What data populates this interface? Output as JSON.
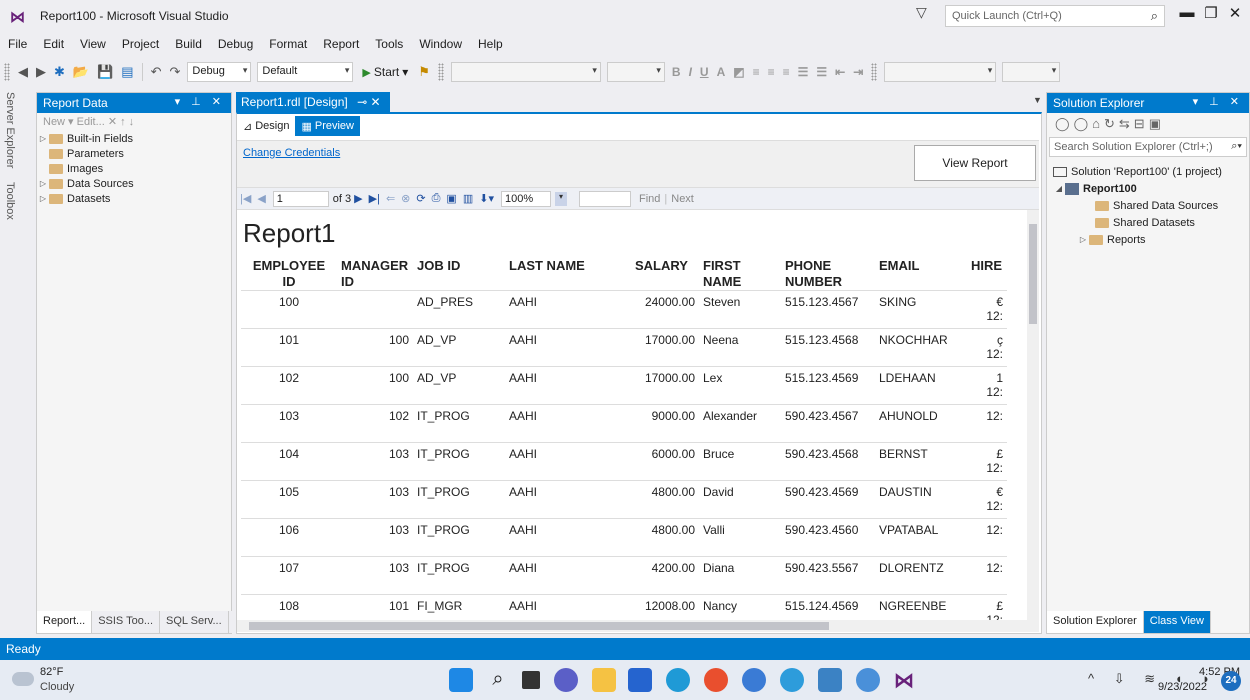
{
  "window": {
    "title": "Report100 - Microsoft Visual Studio",
    "quick_launch_placeholder": "Quick Launch (Ctrl+Q)"
  },
  "menu": [
    "File",
    "Edit",
    "View",
    "Project",
    "Build",
    "Debug",
    "Format",
    "Report",
    "Tools",
    "Window",
    "Help"
  ],
  "toolbar": {
    "config": "Debug",
    "platform": "Default",
    "start_label": "Start"
  },
  "side_tabs": [
    "Server Explorer",
    "Toolbox"
  ],
  "report_data": {
    "title": "Report Data",
    "actions": "New ▾ Edit... ✕ ↑ ↓",
    "items": [
      "Built-in Fields",
      "Parameters",
      "Images",
      "Data Sources",
      "Datasets"
    ],
    "bottom_tabs": [
      "Report...",
      "SSIS Too...",
      "SQL Serv..."
    ]
  },
  "document": {
    "tab_label": "Report1.rdl [Design]",
    "design_tab": "Design",
    "preview_tab": "Preview",
    "change_credentials": "Change Credentials",
    "view_report": "View Report",
    "page_current": "1",
    "page_total": "of 3",
    "zoom": "100%",
    "find_label": "Find",
    "next_label": "Next"
  },
  "report": {
    "title": "Report1",
    "columns": [
      "EMPLOYEE ID",
      "MANAGER ID",
      "JOB ID",
      "LAST NAME",
      "SALARY",
      "FIRST NAME",
      "PHONE NUMBER",
      "EMAIL",
      "HIRE"
    ],
    "rows": [
      {
        "emp": "100",
        "mgr": "",
        "job": "AD_PRES",
        "last": "AAHI",
        "salary": "24000.00",
        "first": "Steven",
        "phone": "515.123.4567",
        "email": "SKING",
        "hire1": "€",
        "hire2": "12:"
      },
      {
        "emp": "101",
        "mgr": "100",
        "job": "AD_VP",
        "last": "AAHI",
        "salary": "17000.00",
        "first": "Neena",
        "phone": "515.123.4568",
        "email": "NKOCHHAR",
        "hire1": "ç",
        "hire2": "12:"
      },
      {
        "emp": "102",
        "mgr": "100",
        "job": "AD_VP",
        "last": "AAHI",
        "salary": "17000.00",
        "first": "Lex",
        "phone": "515.123.4569",
        "email": "LDEHAAN",
        "hire1": "1",
        "hire2": "12:"
      },
      {
        "emp": "103",
        "mgr": "102",
        "job": "IT_PROG",
        "last": "AAHI",
        "salary": "9000.00",
        "first": "Alexander",
        "phone": "590.423.4567",
        "email": "AHUNOLD",
        "hire1": "",
        "hire2": "12:"
      },
      {
        "emp": "104",
        "mgr": "103",
        "job": "IT_PROG",
        "last": "AAHI",
        "salary": "6000.00",
        "first": "Bruce",
        "phone": "590.423.4568",
        "email": "BERNST",
        "hire1": "£",
        "hire2": "12:"
      },
      {
        "emp": "105",
        "mgr": "103",
        "job": "IT_PROG",
        "last": "AAHI",
        "salary": "4800.00",
        "first": "David",
        "phone": "590.423.4569",
        "email": "DAUSTIN",
        "hire1": "€",
        "hire2": "12:"
      },
      {
        "emp": "106",
        "mgr": "103",
        "job": "IT_PROG",
        "last": "AAHI",
        "salary": "4800.00",
        "first": "Valli",
        "phone": "590.423.4560",
        "email": "VPATABAL",
        "hire1": "",
        "hire2": "12:"
      },
      {
        "emp": "107",
        "mgr": "103",
        "job": "IT_PROG",
        "last": "AAHI",
        "salary": "4200.00",
        "first": "Diana",
        "phone": "590.423.5567",
        "email": "DLORENTZ",
        "hire1": "",
        "hire2": "12:"
      },
      {
        "emp": "108",
        "mgr": "101",
        "job": "FI_MGR",
        "last": "AAHI",
        "salary": "12008.00",
        "first": "Nancy",
        "phone": "515.124.4569",
        "email": "NGREENBE",
        "hire1": "£",
        "hire2": "12:"
      }
    ]
  },
  "solution_explorer": {
    "title": "Solution Explorer",
    "search_placeholder": "Search Solution Explorer (Ctrl+;)",
    "solution": "Solution 'Report100' (1 project)",
    "project": "Report100",
    "items": [
      "Shared Data Sources",
      "Shared Datasets",
      "Reports"
    ],
    "bottom_tabs": [
      "Solution Explorer",
      "Class View"
    ]
  },
  "status": "Ready",
  "taskbar": {
    "temperature": "82°F",
    "condition": "Cloudy",
    "time": "4:52 PM",
    "date": "9/23/2022",
    "notifications": "24"
  },
  "colors": {
    "accent": "#007acc",
    "link": "#0066cc",
    "vs_purple": "#68217a"
  }
}
